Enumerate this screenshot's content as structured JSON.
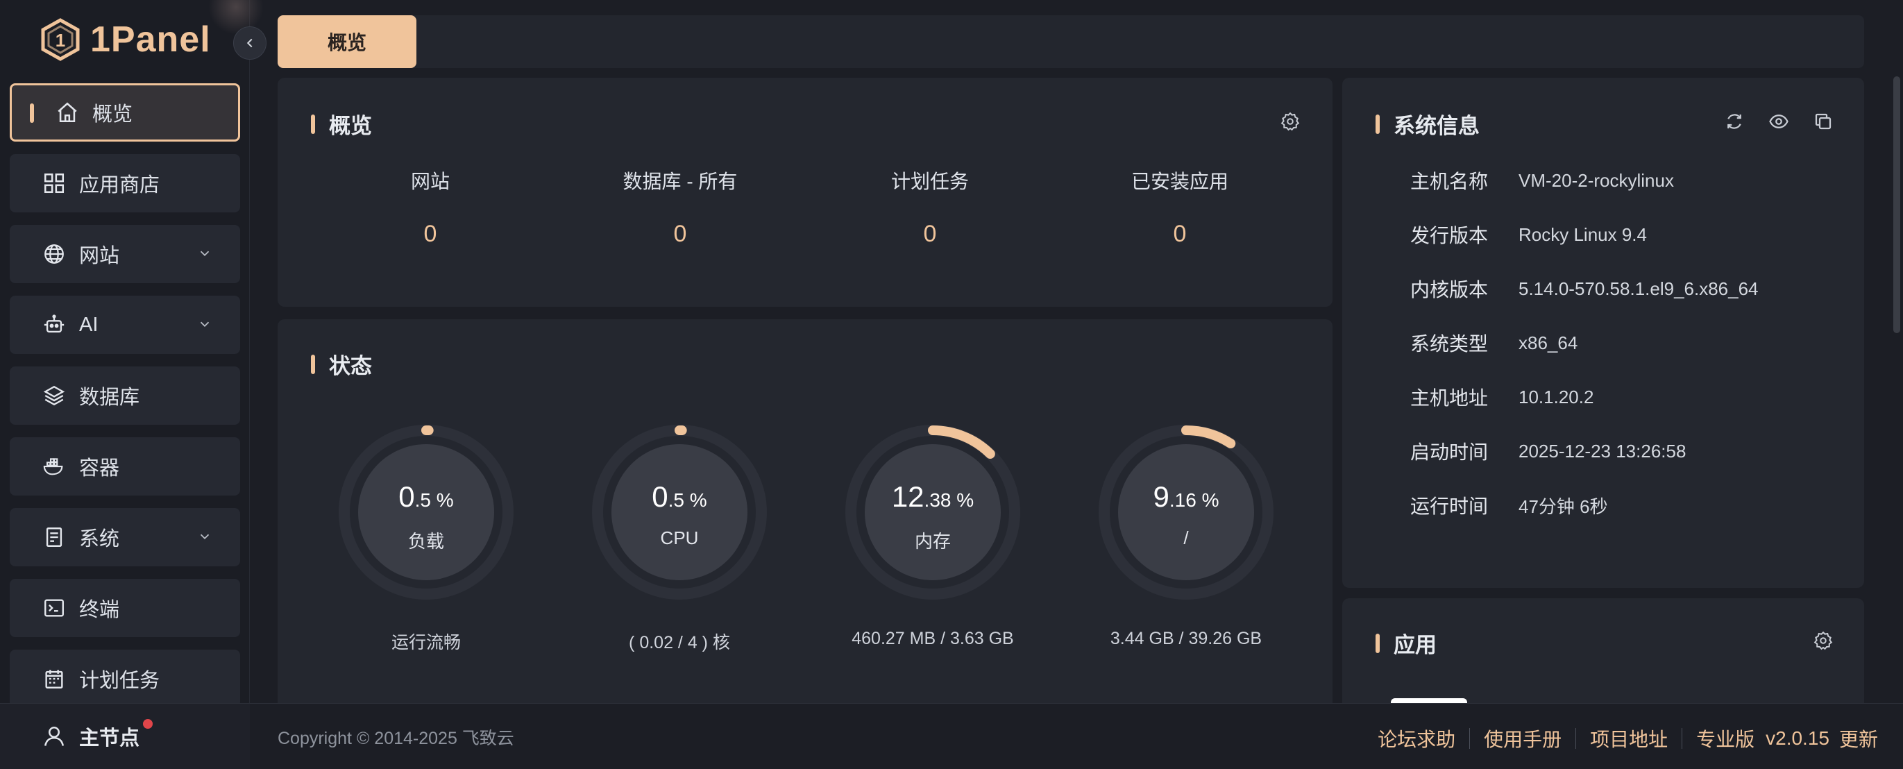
{
  "app": {
    "logo_text": "1Panel"
  },
  "sidebar": {
    "items": [
      {
        "label": "概览",
        "icon": "home-icon",
        "active": true
      },
      {
        "label": "应用商店",
        "icon": "grid-icon"
      },
      {
        "label": "网站",
        "icon": "globe-icon",
        "expandable": true
      },
      {
        "label": "AI",
        "icon": "robot-icon",
        "expandable": true
      },
      {
        "label": "数据库",
        "icon": "layers-icon"
      },
      {
        "label": "容器",
        "icon": "docker-icon"
      },
      {
        "label": "系统",
        "icon": "server-icon",
        "expandable": true
      },
      {
        "label": "终端",
        "icon": "terminal-icon"
      },
      {
        "label": "计划任务",
        "icon": "calendar-icon"
      }
    ],
    "node_label": "主节点"
  },
  "tabs": [
    {
      "label": "概览",
      "active": true
    }
  ],
  "overview": {
    "title": "概览",
    "items": [
      {
        "label": "网站",
        "value": "0"
      },
      {
        "label": "数据库 - 所有",
        "value": "0"
      },
      {
        "label": "计划任务",
        "value": "0"
      },
      {
        "label": "已安装应用",
        "value": "0"
      }
    ]
  },
  "status": {
    "title": "状态",
    "gauges": [
      {
        "int": "0",
        "dec": ".5 %",
        "label": "负载",
        "sub": "运行流畅",
        "percent": 0.5
      },
      {
        "int": "0",
        "dec": ".5 %",
        "label": "CPU",
        "sub": "( 0.02 / 4 ) 核",
        "percent": 0.5
      },
      {
        "int": "12",
        "dec": ".38 %",
        "label": "内存",
        "sub": "460.27 MB / 3.63 GB",
        "percent": 12.38
      },
      {
        "int": "9",
        "dec": ".16 %",
        "label": "/",
        "sub": "3.44 GB / 39.26 GB",
        "percent": 9.16
      }
    ]
  },
  "system_info": {
    "title": "系统信息",
    "rows": [
      {
        "key": "主机名称",
        "value": "VM-20-2-rockylinux"
      },
      {
        "key": "发行版本",
        "value": "Rocky Linux 9.4"
      },
      {
        "key": "内核版本",
        "value": "5.14.0-570.58.1.el9_6.x86_64"
      },
      {
        "key": "系统类型",
        "value": "x86_64"
      },
      {
        "key": "主机地址",
        "value": "10.1.20.2"
      },
      {
        "key": "启动时间",
        "value": "2025-12-23 13:26:58"
      },
      {
        "key": "运行时间",
        "value": "47分钟 6秒"
      }
    ]
  },
  "apps": {
    "title": "应用"
  },
  "footer": {
    "copyright": "Copyright © 2014-2025 飞致云",
    "links": [
      "论坛求助",
      "使用手册",
      "项目地址",
      "专业版"
    ],
    "version": "v2.0.15",
    "update": "更新"
  },
  "colors": {
    "accent": "#f0c49b",
    "background": "#1c1e25",
    "card": "#24272f",
    "notification_dot": "#e0454a"
  }
}
